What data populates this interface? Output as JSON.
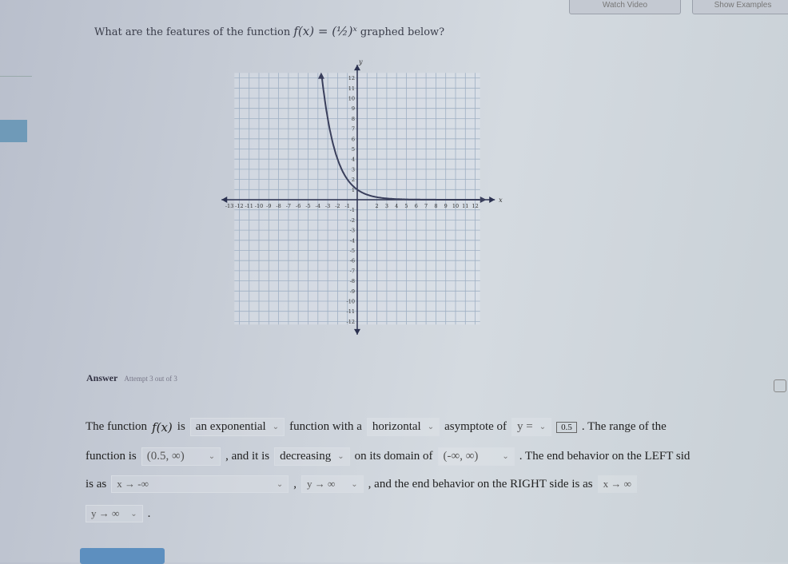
{
  "toolbar": {
    "watch_video": "Watch Video",
    "show_examples": "Show Examples"
  },
  "question": {
    "prefix": "What are the features of the function",
    "function": "f(x) = (½)ˣ",
    "suffix": "graphed below?"
  },
  "answer": {
    "label": "Answer",
    "attempt": "Attempt 3 out of 3"
  },
  "sentence": {
    "t1": "The function",
    "fx": "f(x)",
    "t2": "is",
    "type_select": "an exponential",
    "t3": "function with a",
    "asymptote_select": "horizontal",
    "t4": "asymptote of",
    "asym_eq_select": "y =",
    "asym_value": "0.5",
    "t5": ". The range of the",
    "t6": "function is",
    "range_select": "(0.5, ∞)",
    "t7": ", and it is",
    "direction_select": "decreasing",
    "t8": "on its domain of",
    "domain_select": "(-∞, ∞)",
    "t9": ". The end behavior on the LEFT sid",
    "t10": "is as",
    "left_x_select": "x → -∞",
    "comma": ",",
    "left_y_select": "y → ∞",
    "t11": ", and the end behavior on the RIGHT side is as",
    "right_x_select": "x → ∞",
    "right_y_select": "y → ∞",
    "period": "."
  },
  "chart_data": {
    "type": "line",
    "function": "(1/2)^x",
    "xlabel": "x",
    "ylabel": "y",
    "xlim": [
      -13,
      13
    ],
    "ylim": [
      -12,
      12
    ],
    "x_ticks": [
      -13,
      -12,
      -11,
      -10,
      -9,
      -8,
      -7,
      -6,
      -5,
      -4,
      -3,
      -2,
      -1,
      2,
      3,
      4,
      5,
      6,
      7,
      8,
      9,
      10,
      11,
      12
    ],
    "y_ticks": [
      12,
      11,
      10,
      9,
      8,
      7,
      6,
      5,
      4,
      3,
      2,
      1,
      -1,
      -2,
      -3,
      -4,
      -5,
      -6,
      -7,
      -8,
      -9,
      -10,
      -11,
      -12
    ],
    "grid": true,
    "colors": {
      "grid": "#9fb0c4",
      "axis": "#2b3150",
      "curve": "#3a3f5c"
    }
  }
}
